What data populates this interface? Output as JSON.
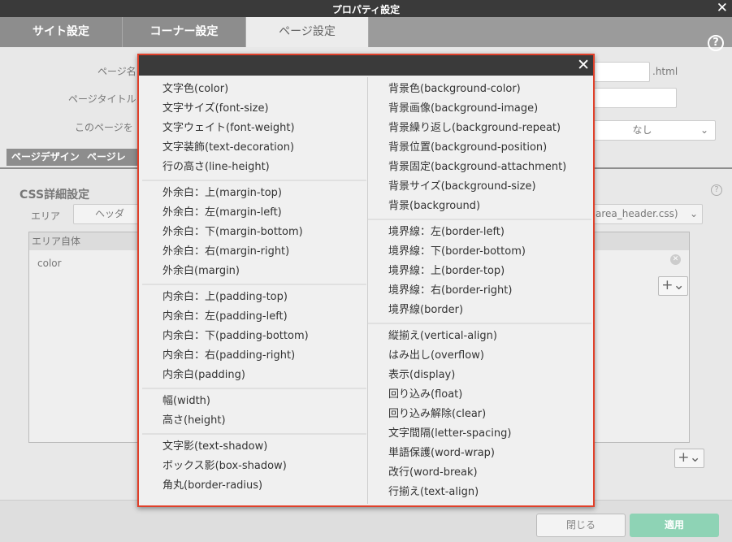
{
  "window": {
    "title": "プロパティ設定"
  },
  "tabs": [
    {
      "label": "サイト設定"
    },
    {
      "label": "コーナー設定"
    },
    {
      "label": "ページ設定"
    }
  ],
  "background": {
    "page_name_label": "ページ名",
    "page_title_label": "ページタイトル",
    "this_page_label": "このページを",
    "ext": ".html",
    "select_value": "なし",
    "subtab1": "ページデザイン",
    "subtab2": "ページレイア",
    "css_title": "CSS詳細設定",
    "area_label": "エリア",
    "area_value": "ヘッダ",
    "file_value": "area_header.css)",
    "area_self": "エリア自体",
    "prop_color": "color",
    "close_button": "閉じる",
    "apply_button": "適用"
  },
  "popup": {
    "left_groups": [
      [
        "文字色(color)",
        "文字サイズ(font-size)",
        "文字ウェイト(font-weight)",
        "文字装飾(text-decoration)",
        "行の高さ(line-height)"
      ],
      [
        "外余白：上(margin-top)",
        "外余白：左(margin-left)",
        "外余白：下(margin-bottom)",
        "外余白：右(margin-right)",
        "外余白(margin)"
      ],
      [
        "内余白：上(padding-top)",
        "内余白：左(padding-left)",
        "内余白：下(padding-bottom)",
        "内余白：右(padding-right)",
        "内余白(padding)"
      ],
      [
        "幅(width)",
        "高さ(height)"
      ],
      [
        "文字影(text-shadow)",
        "ボックス影(box-shadow)",
        "角丸(border-radius)"
      ]
    ],
    "right_groups": [
      [
        "背景色(background-color)",
        "背景画像(background-image)",
        "背景繰り返し(background-repeat)",
        "背景位置(background-position)",
        "背景固定(background-attachment)",
        "背景サイズ(background-size)",
        "背景(background)"
      ],
      [
        "境界線：左(border-left)",
        "境界線：下(border-bottom)",
        "境界線：上(border-top)",
        "境界線：右(border-right)",
        "境界線(border)"
      ],
      [
        "縦揃え(vertical-align)",
        "はみ出し(overflow)",
        "表示(display)",
        "回り込み(float)",
        "回り込み解除(clear)",
        "文字間隔(letter-spacing)",
        "単語保護(word-wrap)",
        "改行(word-break)",
        "行揃え(text-align)"
      ]
    ]
  }
}
